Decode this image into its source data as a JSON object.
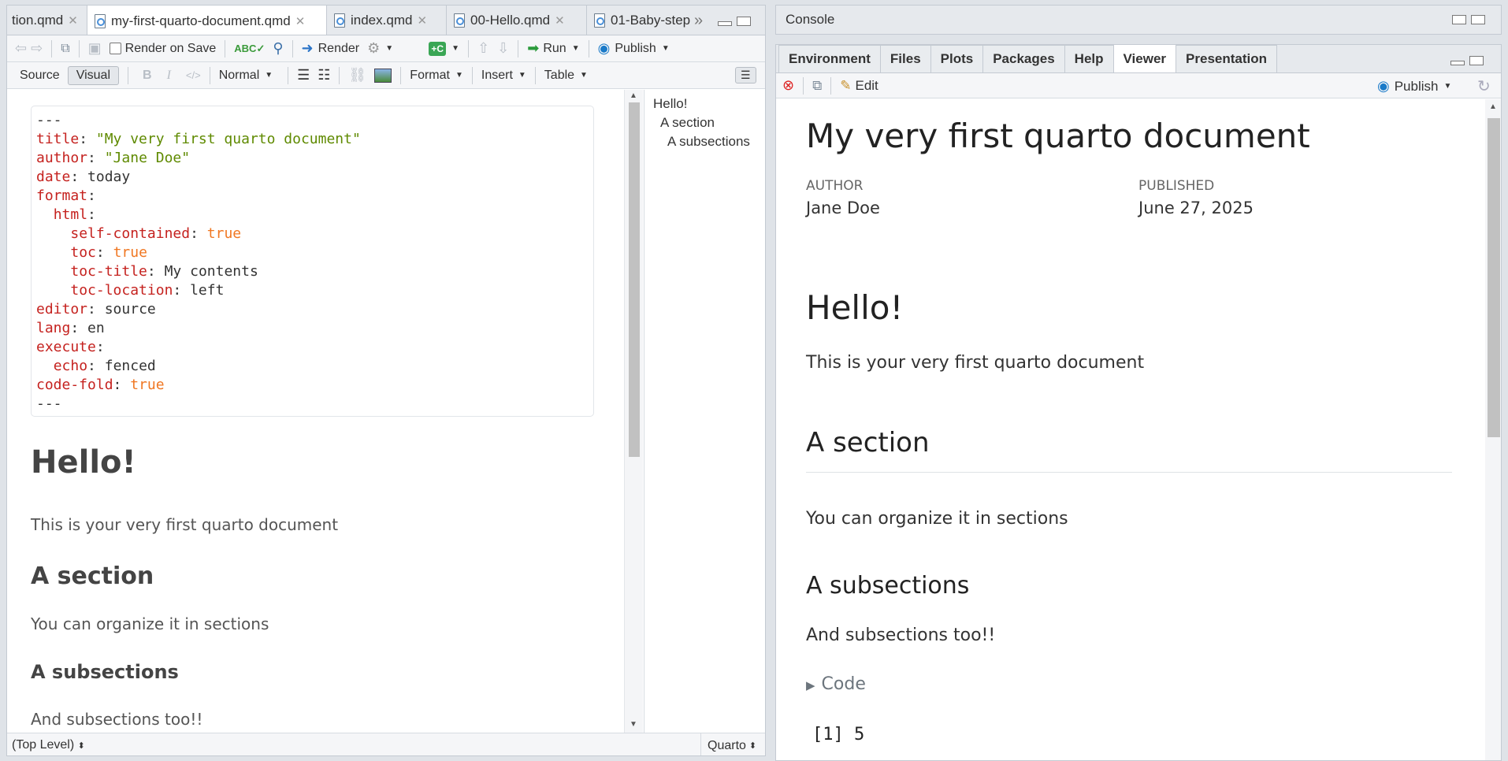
{
  "editor_tabs": [
    {
      "label": "tion.qmd",
      "active": false
    },
    {
      "label": "my-first-quarto-document.qmd",
      "active": true
    },
    {
      "label": "index.qmd",
      "active": false
    },
    {
      "label": "00-Hello.qmd",
      "active": false
    },
    {
      "label": "01-Baby-step",
      "active": false
    }
  ],
  "toolbar1": {
    "render_on_save": "Render on Save",
    "render": "Render",
    "run": "Run",
    "publish": "Publish"
  },
  "toolbar2": {
    "source": "Source",
    "visual": "Visual",
    "bold": "B",
    "italic": "I",
    "code": "</>",
    "block_format": "Normal",
    "format": "Format",
    "insert": "Insert",
    "table": "Table"
  },
  "yaml": {
    "delim": "---",
    "lines": [
      {
        "indent": 0,
        "key": "title",
        "value": "\"My very first quarto document\"",
        "type": "s"
      },
      {
        "indent": 0,
        "key": "author",
        "value": "\"Jane Doe\"",
        "type": "s"
      },
      {
        "indent": 0,
        "key": "date",
        "value": "today",
        "type": "p"
      },
      {
        "indent": 0,
        "key": "format",
        "value": "",
        "type": "p"
      },
      {
        "indent": 1,
        "key": "html",
        "value": "",
        "type": "p"
      },
      {
        "indent": 2,
        "key": "self-contained",
        "value": "true",
        "type": "b"
      },
      {
        "indent": 2,
        "key": "toc",
        "value": "true",
        "type": "b"
      },
      {
        "indent": 2,
        "key": "toc-title",
        "value": "My contents",
        "type": "p"
      },
      {
        "indent": 2,
        "key": "toc-location",
        "value": "left",
        "type": "p"
      },
      {
        "indent": 0,
        "key": "editor",
        "value": "source",
        "type": "p"
      },
      {
        "indent": 0,
        "key": "lang",
        "value": "en",
        "type": "p"
      },
      {
        "indent": 0,
        "key": "execute",
        "value": "",
        "type": "p"
      },
      {
        "indent": 1,
        "key": "echo",
        "value": "fenced",
        "type": "p"
      },
      {
        "indent": 0,
        "key": "code-fold",
        "value": "true",
        "type": "b"
      }
    ]
  },
  "doc": {
    "h1": "Hello!",
    "p1": "This is your very first quarto document",
    "h2": "A section",
    "p2": "You can organize it in sections",
    "h3": "A subsections",
    "p3": "And subsections too!!"
  },
  "outline": [
    "Hello!",
    "A section",
    "A subsections"
  ],
  "status": {
    "level": "(Top Level)",
    "mode": "Quarto"
  },
  "console_label": "Console",
  "right_tabs": [
    {
      "label": "Environment",
      "active": false
    },
    {
      "label": "Files",
      "active": false
    },
    {
      "label": "Plots",
      "active": false
    },
    {
      "label": "Packages",
      "active": false
    },
    {
      "label": "Help",
      "active": false
    },
    {
      "label": "Viewer",
      "active": true
    },
    {
      "label": "Presentation",
      "active": false
    }
  ],
  "viewer_toolbar": {
    "edit": "Edit",
    "publish": "Publish"
  },
  "viewer": {
    "title": "My very first quarto document",
    "author_label": "AUTHOR",
    "author": "Jane Doe",
    "published_label": "PUBLISHED",
    "published": "June 27, 2025",
    "h1": "Hello!",
    "p1": "This is your very first quarto document",
    "h2": "A section",
    "p2": "You can organize it in sections",
    "h3": "A subsections",
    "p3": "And subsections too!!",
    "code_toggle": "Code",
    "output": "[1] 5"
  },
  "colors": {
    "yaml_key": "#c5221f",
    "yaml_string": "#5f8a00",
    "yaml_bool": "#f07722",
    "accent": "#1a7ac8"
  }
}
